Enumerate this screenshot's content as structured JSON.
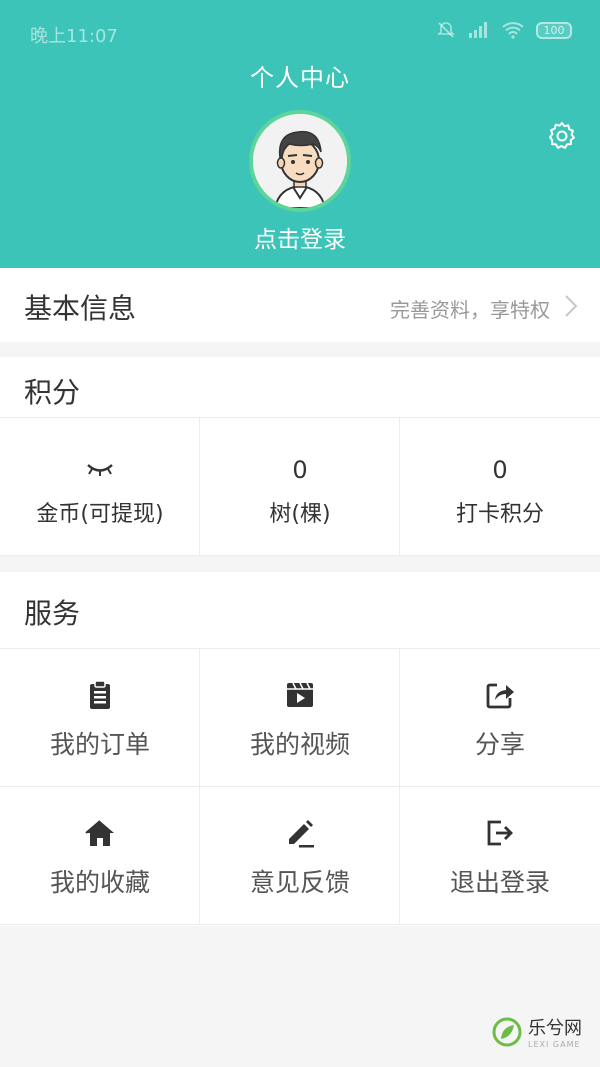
{
  "status_bar": {
    "time": "晚上11:07",
    "battery": "100"
  },
  "header": {
    "title": "个人中心",
    "login": "点击登录",
    "accent": "#3dc4b9"
  },
  "basic_info": {
    "title": "基本信息",
    "hint": "完善资料，享特权"
  },
  "points": {
    "title": "积分",
    "items": [
      {
        "value": "",
        "label": "金币(可提现)",
        "icon": "closed-eye-icon"
      },
      {
        "value": "0",
        "label": "树(棵)"
      },
      {
        "value": "0",
        "label": "打卡积分"
      }
    ]
  },
  "services": {
    "title": "服务",
    "items": [
      {
        "label": "我的订单",
        "icon": "clipboard-icon"
      },
      {
        "label": "我的视频",
        "icon": "video-icon"
      },
      {
        "label": "分享",
        "icon": "share-icon"
      },
      {
        "label": "我的收藏",
        "icon": "home-icon"
      },
      {
        "label": "意见反馈",
        "icon": "edit-icon"
      },
      {
        "label": "退出登录",
        "icon": "logout-icon"
      }
    ]
  },
  "watermark": {
    "name": "乐兮网",
    "sub": "LEXI GAME"
  }
}
